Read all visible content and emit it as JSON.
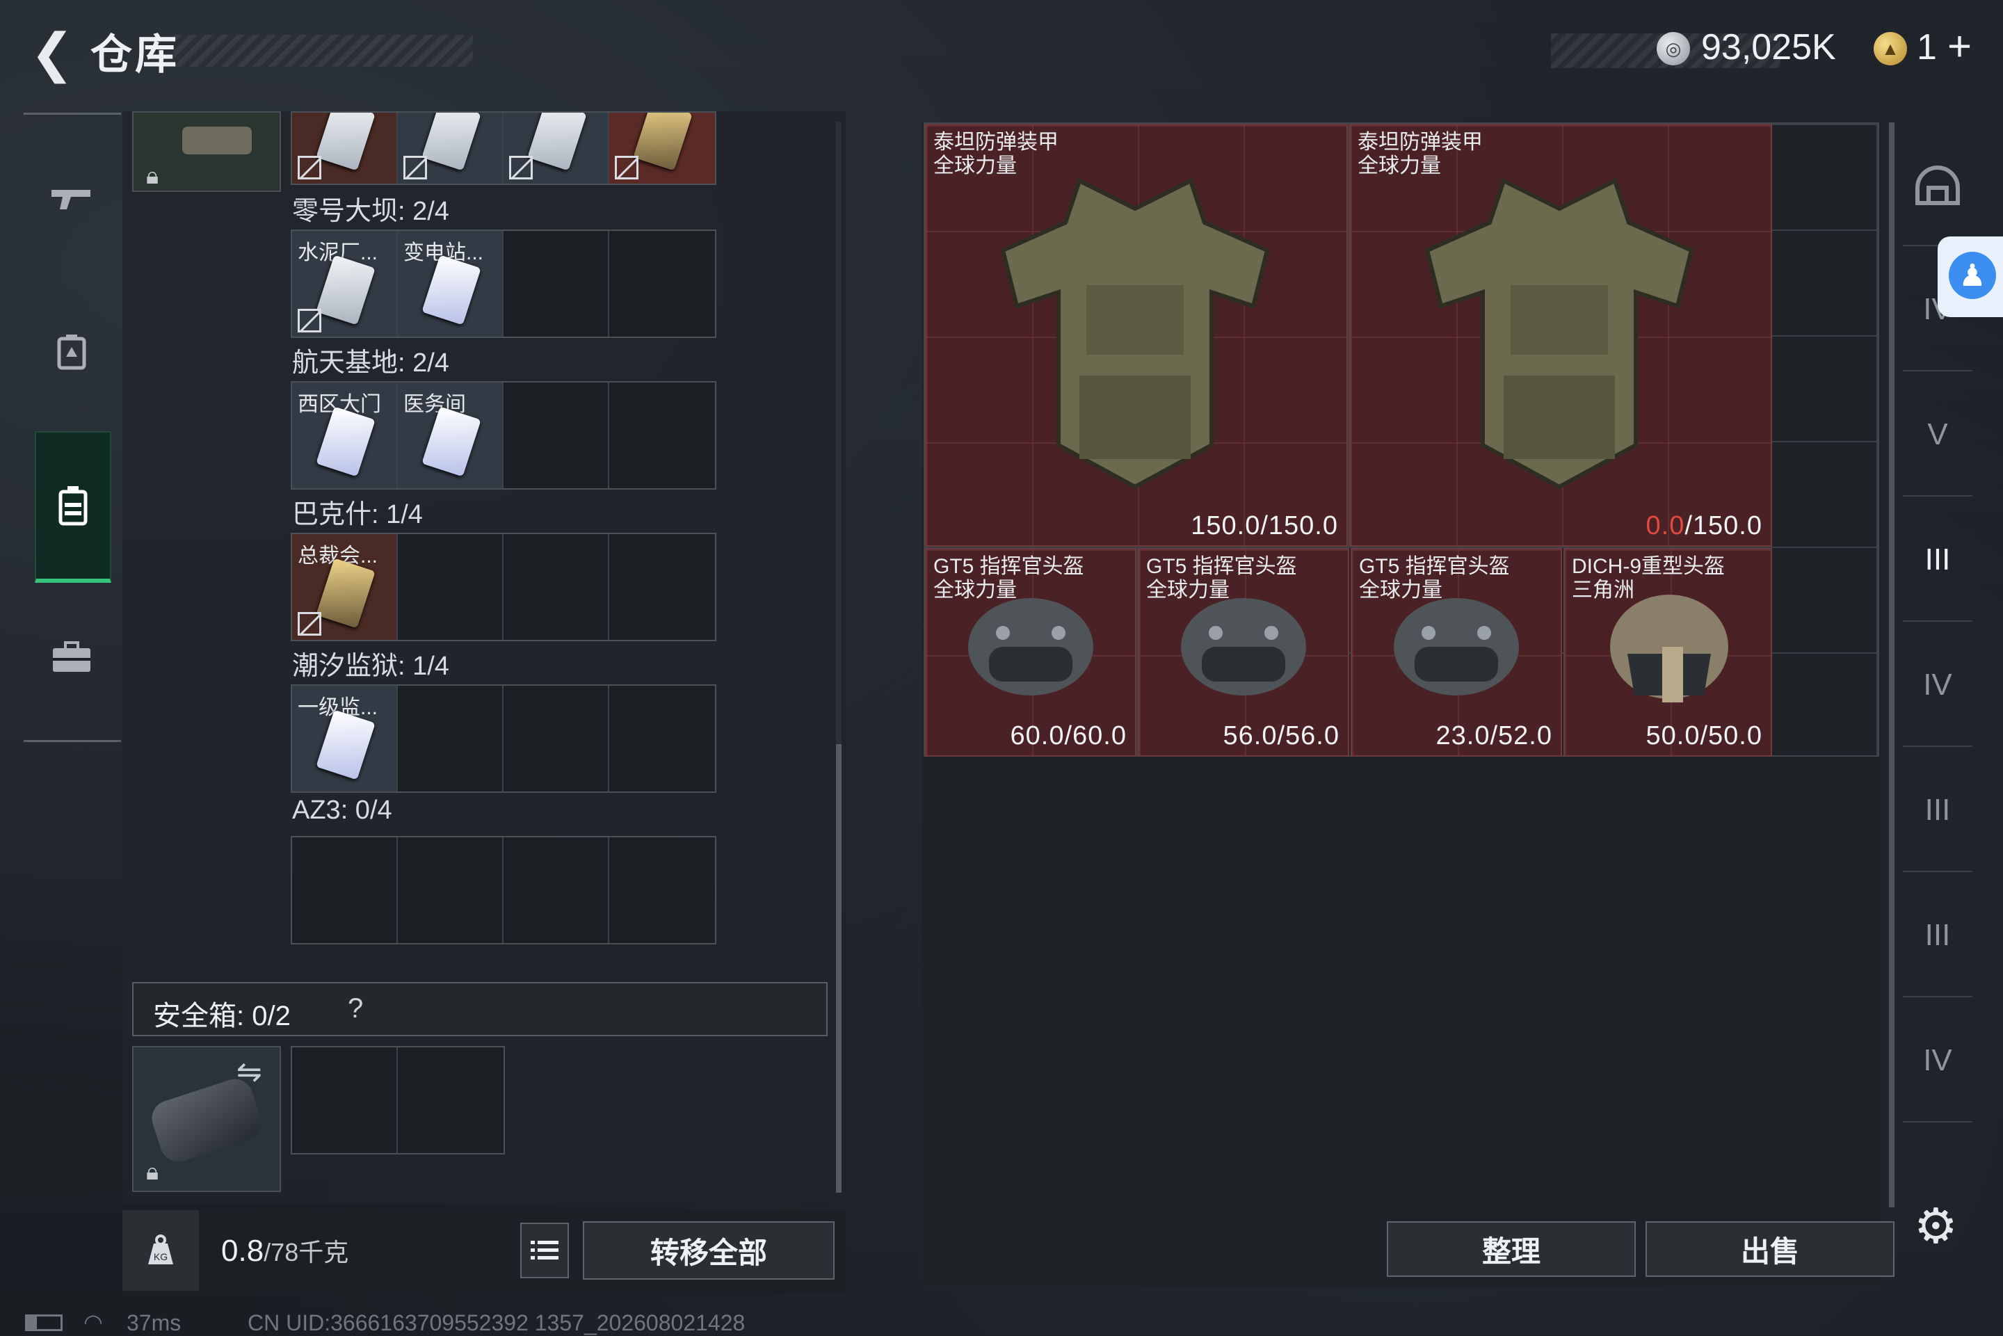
{
  "header": {
    "title": "仓库",
    "currency_1": "93,025K",
    "currency_2": "1",
    "plus": "+"
  },
  "nav": {
    "items": [
      "weapons",
      "armor",
      "backpack",
      "case"
    ],
    "active": "backpack"
  },
  "inventory": {
    "top_slot_cards": 4,
    "groups": [
      {
        "label": "零号大坝: 2/4",
        "cards": [
          {
            "name": "水泥厂..."
          },
          {
            "name": "变电站..."
          }
        ]
      },
      {
        "label": "航天基地: 2/4",
        "cards": [
          {
            "name": "西区大门"
          },
          {
            "name": "医务间"
          }
        ]
      },
      {
        "label": "巴克什: 1/4",
        "cards": [
          {
            "name": "总裁会..."
          }
        ]
      },
      {
        "label": "潮汐监狱: 1/4",
        "cards": [
          {
            "name": "一级监..."
          }
        ]
      },
      {
        "label": "AZ3: 0/4",
        "cards": []
      }
    ],
    "safe_box": {
      "label": "安全箱:  0/2",
      "help": "?"
    },
    "weight": {
      "value": "0.8",
      "total": "/78千克"
    },
    "transfer_all": "转移全部"
  },
  "stash": {
    "armors": [
      {
        "name": "泰坦防弹装甲",
        "source": "全球力量",
        "durability": "150.0",
        "max": "/150.0",
        "broken": false
      },
      {
        "name": "泰坦防弹装甲",
        "source": "全球力量",
        "durability": "0.0",
        "max": "/150.0",
        "broken": true
      }
    ],
    "helmets": [
      {
        "name": "GT5 指挥官头盔",
        "source": "全球力量",
        "durability": "60.0/60.0"
      },
      {
        "name": "GT5 指挥官头盔",
        "source": "全球力量",
        "durability": "56.0/56.0"
      },
      {
        "name": "GT5 指挥官头盔",
        "source": "全球力量",
        "durability": "23.0/52.0"
      },
      {
        "name": "DICH-9重型头盔",
        "source": "三角洲",
        "durability": "50.0/50.0"
      }
    ],
    "sort_button": "整理",
    "sell_button": "出售"
  },
  "filters": [
    "helmet-all",
    "IV",
    "V",
    "III",
    "IV",
    "III",
    "III",
    "IV"
  ],
  "status": {
    "ping": "37ms",
    "uid": "CN UID:3666163709552392 1357_202608021428"
  },
  "colors": {
    "accent_green": "#37c27e",
    "item_red": "#4a2226",
    "broken_red": "#e04a3f"
  }
}
